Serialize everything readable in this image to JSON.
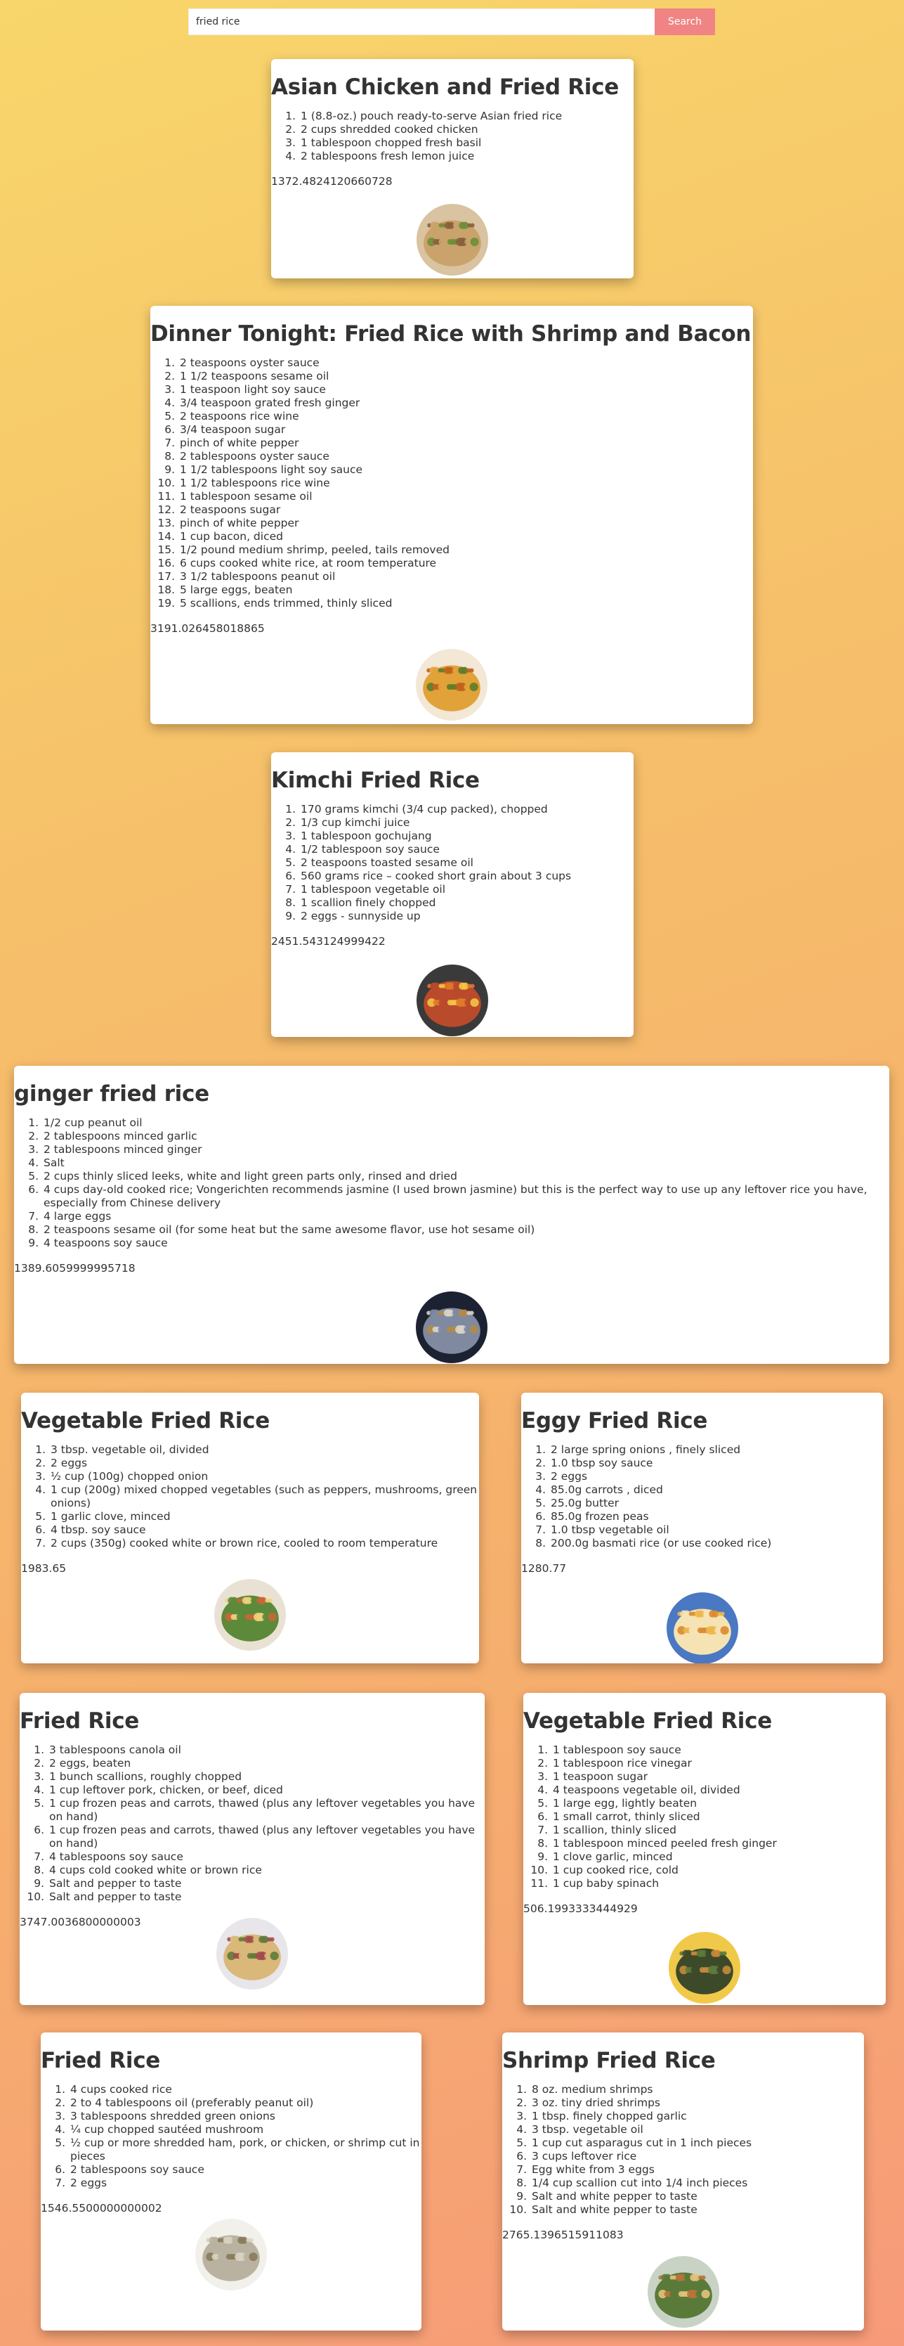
{
  "search": {
    "value": "fried rice",
    "placeholder": "",
    "button_label": "Search"
  },
  "recipes": [
    {
      "title": "Asian Chicken and Fried Rice",
      "ingredients": [
        "1 (8.8-oz.) pouch ready-to-serve Asian fried rice",
        "2 cups shredded cooked chicken",
        "1 tablespoon chopped fresh basil",
        "2 tablespoons fresh lemon juice"
      ],
      "number": "1372.4824120660728"
    },
    {
      "title": "Dinner Tonight: Fried Rice with Shrimp and Bacon Recipe",
      "ingredients": [
        "2 teaspoons oyster sauce",
        "1 1/2 teaspoons sesame oil",
        "1 teaspoon light soy sauce",
        "3/4 teaspoon grated fresh ginger",
        "2 teaspoons rice wine",
        "3/4 teaspoon sugar",
        "pinch of white pepper",
        "2 tablespoons oyster sauce",
        "1 1/2 tablespoons light soy sauce",
        "1 1/2 tablespoons rice wine",
        "1 tablespoon sesame oil",
        "2 teaspoons sugar",
        "pinch of white pepper",
        "1 cup bacon, diced",
        "1/2 pound medium shrimp, peeled, tails removed",
        "6 cups cooked white rice, at room temperature",
        "3 1/2 tablespoons peanut oil",
        "5 large eggs, beaten",
        "5 scallions, ends trimmed, thinly sliced"
      ],
      "number": "3191.026458018865"
    },
    {
      "title": "Kimchi Fried Rice",
      "ingredients": [
        "170 grams kimchi (3/4 cup packed), chopped",
        "1/3 cup kimchi juice",
        "1 tablespoon gochujang",
        "1/2 tablespoon soy sauce",
        "2 teaspoons toasted sesame oil",
        "560 grams rice – cooked short grain about 3 cups",
        "1 tablespoon vegetable oil",
        "1 scallion finely chopped",
        "2 eggs - sunnyside up"
      ],
      "number": "2451.543124999422"
    },
    {
      "title": "ginger fried rice",
      "ingredients": [
        "1/2 cup peanut oil",
        "2 tablespoons minced garlic",
        "2 tablespoons minced ginger",
        "Salt",
        "2 cups thinly sliced leeks, white and light green parts only, rinsed and dried",
        "4 cups day-old cooked rice; Vongerichten recommends jasmine (I used brown jasmine) but this is the perfect way to use up any leftover rice you have, especially from Chinese delivery",
        "4 large eggs",
        "2 teaspoons sesame oil (for some heat but the same awesome flavor, use hot sesame oil)",
        "4 teaspoons soy sauce"
      ],
      "number": "1389.6059999995718"
    },
    {
      "title": "Vegetable Fried Rice",
      "ingredients": [
        "3 tbsp. vegetable oil, divided",
        "2 eggs",
        "½ cup (100g) chopped onion",
        "1 cup (200g) mixed chopped vegetables (such as peppers, mushrooms, green onions)",
        "1 garlic clove, minced",
        "4 tbsp. soy sauce",
        "2 cups (350g) cooked white or brown rice, cooled to room temperature"
      ],
      "number": "1983.65"
    },
    {
      "title": "Eggy Fried Rice",
      "ingredients": [
        "2 large spring onions , finely sliced",
        "1.0 tbsp soy sauce",
        "2 eggs",
        "85.0g carrots , diced",
        "25.0g butter",
        "85.0g frozen peas",
        "1.0 tbsp vegetable oil",
        "200.0g basmati rice (or use cooked rice)"
      ],
      "number": "1280.77"
    },
    {
      "title": "Fried Rice",
      "ingredients": [
        "3 tablespoons canola oil",
        "2 eggs, beaten",
        "1 bunch scallions, roughly chopped",
        "1 cup leftover pork, chicken, or beef, diced",
        "1 cup frozen peas and carrots, thawed (plus any leftover vegetables you have on hand)",
        "1 cup frozen peas and carrots, thawed (plus any leftover vegetables you have on hand)",
        "4 tablespoons soy sauce",
        "4 cups cold cooked white or brown rice",
        "Salt and pepper to taste",
        "Salt and pepper to taste"
      ],
      "number": "3747.0036800000003"
    },
    {
      "title": "Vegetable Fried Rice",
      "ingredients": [
        "1 tablespoon soy sauce",
        "1 tablespoon rice vinegar",
        "1 teaspoon sugar",
        "4 teaspoons vegetable oil, divided",
        "1 large egg, lightly beaten",
        "1 small carrot, thinly sliced",
        "1 scallion, thinly sliced",
        "1 tablespoon minced peeled fresh ginger",
        "1 clove garlic, minced",
        "1 cup cooked rice, cold",
        "1 cup baby spinach"
      ],
      "number": "506.1993333444929"
    },
    {
      "title": "Fried Rice",
      "ingredients": [
        "4 cups cooked rice",
        "2 to 4 tablespoons oil (preferably peanut oil)",
        "3 tablespoons shredded green onions",
        "¼ cup chopped sautéed mushroom",
        "½ cup or more shredded ham, pork, or chicken, or shrimp cut in pieces",
        "2 tablespoons soy sauce",
        "2 eggs"
      ],
      "number": "1546.5500000000002"
    },
    {
      "title": "Shrimp Fried Rice",
      "ingredients": [
        "8 oz. medium shrimps",
        "3 oz. tiny dried shrimps",
        "1 tbsp. finely chopped garlic",
        "3 tbsp. vegetable oil",
        "1 cup cut asparagus cut in 1 inch pieces",
        "3 cups leftover rice",
        "Egg white from 3 eggs",
        "1/4 cup scallion cut into 1/4 inch pieces",
        "Salt and white pepper to taste",
        "Salt and white pepper to taste"
      ],
      "number": "2765.1396515911083"
    }
  ]
}
